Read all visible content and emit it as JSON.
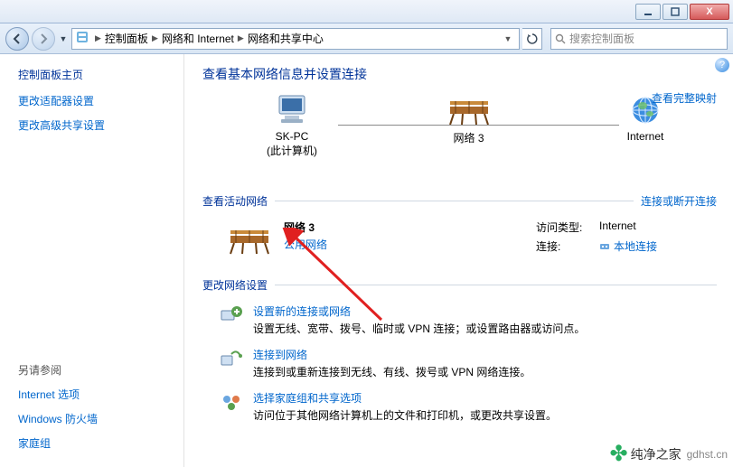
{
  "titlebar": {
    "min": "–",
    "max": "☐",
    "close": "X"
  },
  "breadcrumb": {
    "root": "控制面板",
    "mid": "网络和 Internet",
    "leaf": "网络和共享中心"
  },
  "search": {
    "placeholder": "搜索控制面板"
  },
  "sidebar": {
    "title": "控制面板主页",
    "links": [
      "更改适配器设置",
      "更改高级共享设置"
    ],
    "also_label": "另请参阅",
    "also": [
      "Internet 选项",
      "Windows 防火墙",
      "家庭组"
    ]
  },
  "content": {
    "heading": "查看基本网络信息并设置连接",
    "fullmap": "查看完整映射",
    "map": {
      "pc_name": "SK-PC",
      "pc_sub": "(此计算机)",
      "net_name": "网络  3",
      "inet": "Internet"
    },
    "active": {
      "title": "查看活动网络",
      "disconnect": "连接或断开连接",
      "net_name": "网络  3",
      "net_type": "公用网络",
      "access_k": "访问类型:",
      "access_v": "Internet",
      "conn_k": "连接:",
      "conn_v": "本地连接"
    },
    "change": {
      "title": "更改网络设置",
      "items": [
        {
          "name": "设置新的连接或网络",
          "desc": "设置无线、宽带、拨号、临时或 VPN 连接；或设置路由器或访问点。"
        },
        {
          "name": "连接到网络",
          "desc": "连接到或重新连接到无线、有线、拨号或 VPN 网络连接。"
        },
        {
          "name": "选择家庭组和共享选项",
          "desc": "访问位于其他网络计算机上的文件和打印机，或更改共享设置。"
        }
      ]
    }
  },
  "watermark": {
    "main": "纯净之家",
    "sub": "gdhst.cn"
  }
}
